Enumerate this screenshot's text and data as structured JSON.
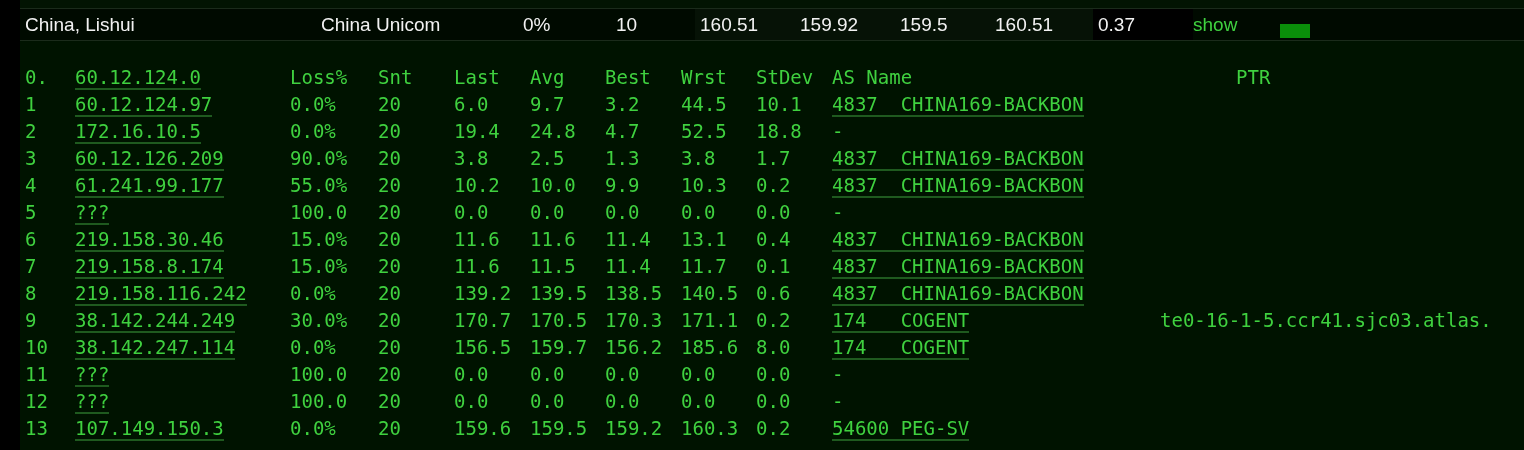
{
  "summary": {
    "location": "China, Lishui",
    "isp": "China Unicom",
    "loss": "0%",
    "sent": "10",
    "last": "160.51",
    "avg": "159.92",
    "best": "159.5",
    "worst": "160.51",
    "stdev": "0.37",
    "action": "show"
  },
  "trace": {
    "target_hop": "0.",
    "target_host": "60.12.124.0",
    "columns": [
      "Loss%",
      "Snt",
      "Last",
      "Avg",
      "Best",
      "Wrst",
      "StDev",
      "AS Name",
      "PTR"
    ],
    "rows": [
      {
        "hop": "1",
        "host": "60.12.124.97",
        "loss": "0.0%",
        "snt": "20",
        "last": "6.0",
        "avg": "9.7",
        "best": "3.2",
        "wrst": "44.5",
        "stdev": "10.1",
        "as": "4837  CHINA169-BACKBON",
        "as_linked": true,
        "ptr": ""
      },
      {
        "hop": "2",
        "host": "172.16.10.5",
        "loss": "0.0%",
        "snt": "20",
        "last": "19.4",
        "avg": "24.8",
        "best": "4.7",
        "wrst": "52.5",
        "stdev": "18.8",
        "as": "-",
        "as_linked": false,
        "ptr": ""
      },
      {
        "hop": "3",
        "host": "60.12.126.209",
        "loss": "90.0%",
        "snt": "20",
        "last": "3.8",
        "avg": "2.5",
        "best": "1.3",
        "wrst": "3.8",
        "stdev": "1.7",
        "as": "4837  CHINA169-BACKBON",
        "as_linked": true,
        "ptr": ""
      },
      {
        "hop": "4",
        "host": "61.241.99.177",
        "loss": "55.0%",
        "snt": "20",
        "last": "10.2",
        "avg": "10.0",
        "best": "9.9",
        "wrst": "10.3",
        "stdev": "0.2",
        "as": "4837  CHINA169-BACKBON",
        "as_linked": true,
        "ptr": ""
      },
      {
        "hop": "5",
        "host": "???",
        "loss": "100.0",
        "snt": "20",
        "last": "0.0",
        "avg": "0.0",
        "best": "0.0",
        "wrst": "0.0",
        "stdev": "0.0",
        "as": "-",
        "as_linked": false,
        "ptr": ""
      },
      {
        "hop": "6",
        "host": "219.158.30.46",
        "loss": "15.0%",
        "snt": "20",
        "last": "11.6",
        "avg": "11.6",
        "best": "11.4",
        "wrst": "13.1",
        "stdev": "0.4",
        "as": "4837  CHINA169-BACKBON",
        "as_linked": true,
        "ptr": ""
      },
      {
        "hop": "7",
        "host": "219.158.8.174",
        "loss": "15.0%",
        "snt": "20",
        "last": "11.6",
        "avg": "11.5",
        "best": "11.4",
        "wrst": "11.7",
        "stdev": "0.1",
        "as": "4837  CHINA169-BACKBON",
        "as_linked": true,
        "ptr": ""
      },
      {
        "hop": "8",
        "host": "219.158.116.242",
        "loss": "0.0%",
        "snt": "20",
        "last": "139.2",
        "avg": "139.5",
        "best": "138.5",
        "wrst": "140.5",
        "stdev": "0.6",
        "as": "4837  CHINA169-BACKBON",
        "as_linked": true,
        "ptr": ""
      },
      {
        "hop": "9",
        "host": "38.142.244.249",
        "loss": "30.0%",
        "snt": "20",
        "last": "170.7",
        "avg": "170.5",
        "best": "170.3",
        "wrst": "171.1",
        "stdev": "0.2",
        "as": "174   COGENT",
        "as_linked": true,
        "ptr": "te0-16-1-5.ccr41.sjc03.atlas."
      },
      {
        "hop": "10",
        "host": "38.142.247.114",
        "loss": "0.0%",
        "snt": "20",
        "last": "156.5",
        "avg": "159.7",
        "best": "156.2",
        "wrst": "185.6",
        "stdev": "8.0",
        "as": "174   COGENT",
        "as_linked": true,
        "ptr": ""
      },
      {
        "hop": "11",
        "host": "???",
        "loss": "100.0",
        "snt": "20",
        "last": "0.0",
        "avg": "0.0",
        "best": "0.0",
        "wrst": "0.0",
        "stdev": "0.0",
        "as": "-",
        "as_linked": false,
        "ptr": ""
      },
      {
        "hop": "12",
        "host": "???",
        "loss": "100.0",
        "snt": "20",
        "last": "0.0",
        "avg": "0.0",
        "best": "0.0",
        "wrst": "0.0",
        "stdev": "0.0",
        "as": "-",
        "as_linked": false,
        "ptr": ""
      },
      {
        "hop": "13",
        "host": "107.149.150.3",
        "loss": "0.0%",
        "snt": "20",
        "last": "159.6",
        "avg": "159.5",
        "best": "159.2",
        "wrst": "160.3",
        "stdev": "0.2",
        "as": "54600 PEG-SV",
        "as_linked": true,
        "ptr": ""
      }
    ]
  }
}
